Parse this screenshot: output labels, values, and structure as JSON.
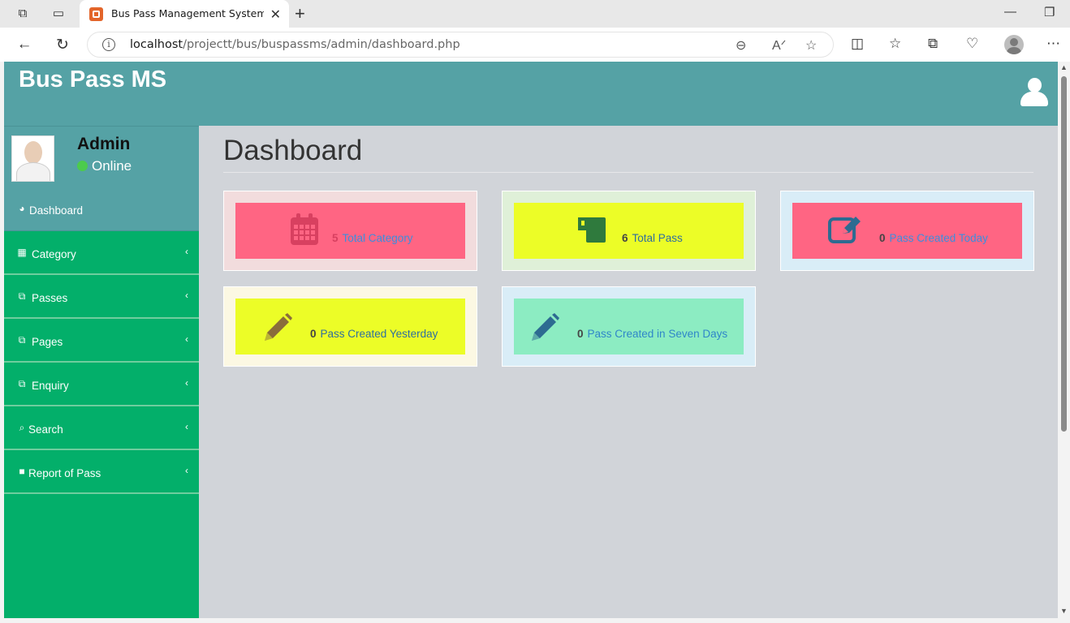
{
  "browser": {
    "tab_title": "Bus Pass Management System | D",
    "url_host": "localhost",
    "url_path": "/projectt/bus/buspassms/admin/dashboard.php"
  },
  "header": {
    "brand": "Bus Pass MS"
  },
  "profile": {
    "name": "Admin",
    "status": "Online"
  },
  "sidebar": {
    "items": [
      {
        "label": "Dashboard",
        "icon": "dashboard-icon"
      },
      {
        "label": "Category",
        "icon": "chart-icon"
      },
      {
        "label": "Passes",
        "icon": "files-icon"
      },
      {
        "label": "Pages",
        "icon": "files-icon"
      },
      {
        "label": "Enquiry",
        "icon": "files-icon"
      },
      {
        "label": "Search",
        "icon": "search-icon"
      },
      {
        "label": "Report of Pass",
        "icon": "folder-icon"
      }
    ]
  },
  "main": {
    "title": "Dashboard",
    "cards": [
      {
        "count": "5",
        "label": "Total Category",
        "icon": "calendar-icon",
        "outer": "#f2dcdd",
        "inner": "#ff6583",
        "icon_color": "#d84060",
        "label_color": "#3c8dde",
        "count_color": "#d84060"
      },
      {
        "count": "6",
        "label": "Total Pass",
        "icon": "mug-icon",
        "outer": "#dff0d8",
        "inner": "#ecfd27",
        "icon_color": "#2f7a3d",
        "label_color": "#2f6e9e",
        "count_color": "#444"
      },
      {
        "count": "0",
        "label": "Pass Created Today",
        "icon": "edit-icon",
        "outer": "#d9edf7",
        "inner": "#ff6583",
        "icon_color": "#2d6b91",
        "label_color": "#3c8dde",
        "count_color": "#444"
      },
      {
        "count": "0",
        "label": "Pass Created Yesterday",
        "icon": "pencil-icon",
        "outer": "#fcf8e3",
        "inner": "#ecfd27",
        "icon_color": "#8a6d3b",
        "label_color": "#2f6e9e",
        "count_color": "#444"
      },
      {
        "count": "0",
        "label": "Pass Created in Seven Days",
        "icon": "pencil-icon",
        "outer": "#d9edf7",
        "inner": "#8cecc2",
        "icon_color": "#2d6b91",
        "label_color": "#2f86c9",
        "count_color": "#444"
      }
    ]
  }
}
